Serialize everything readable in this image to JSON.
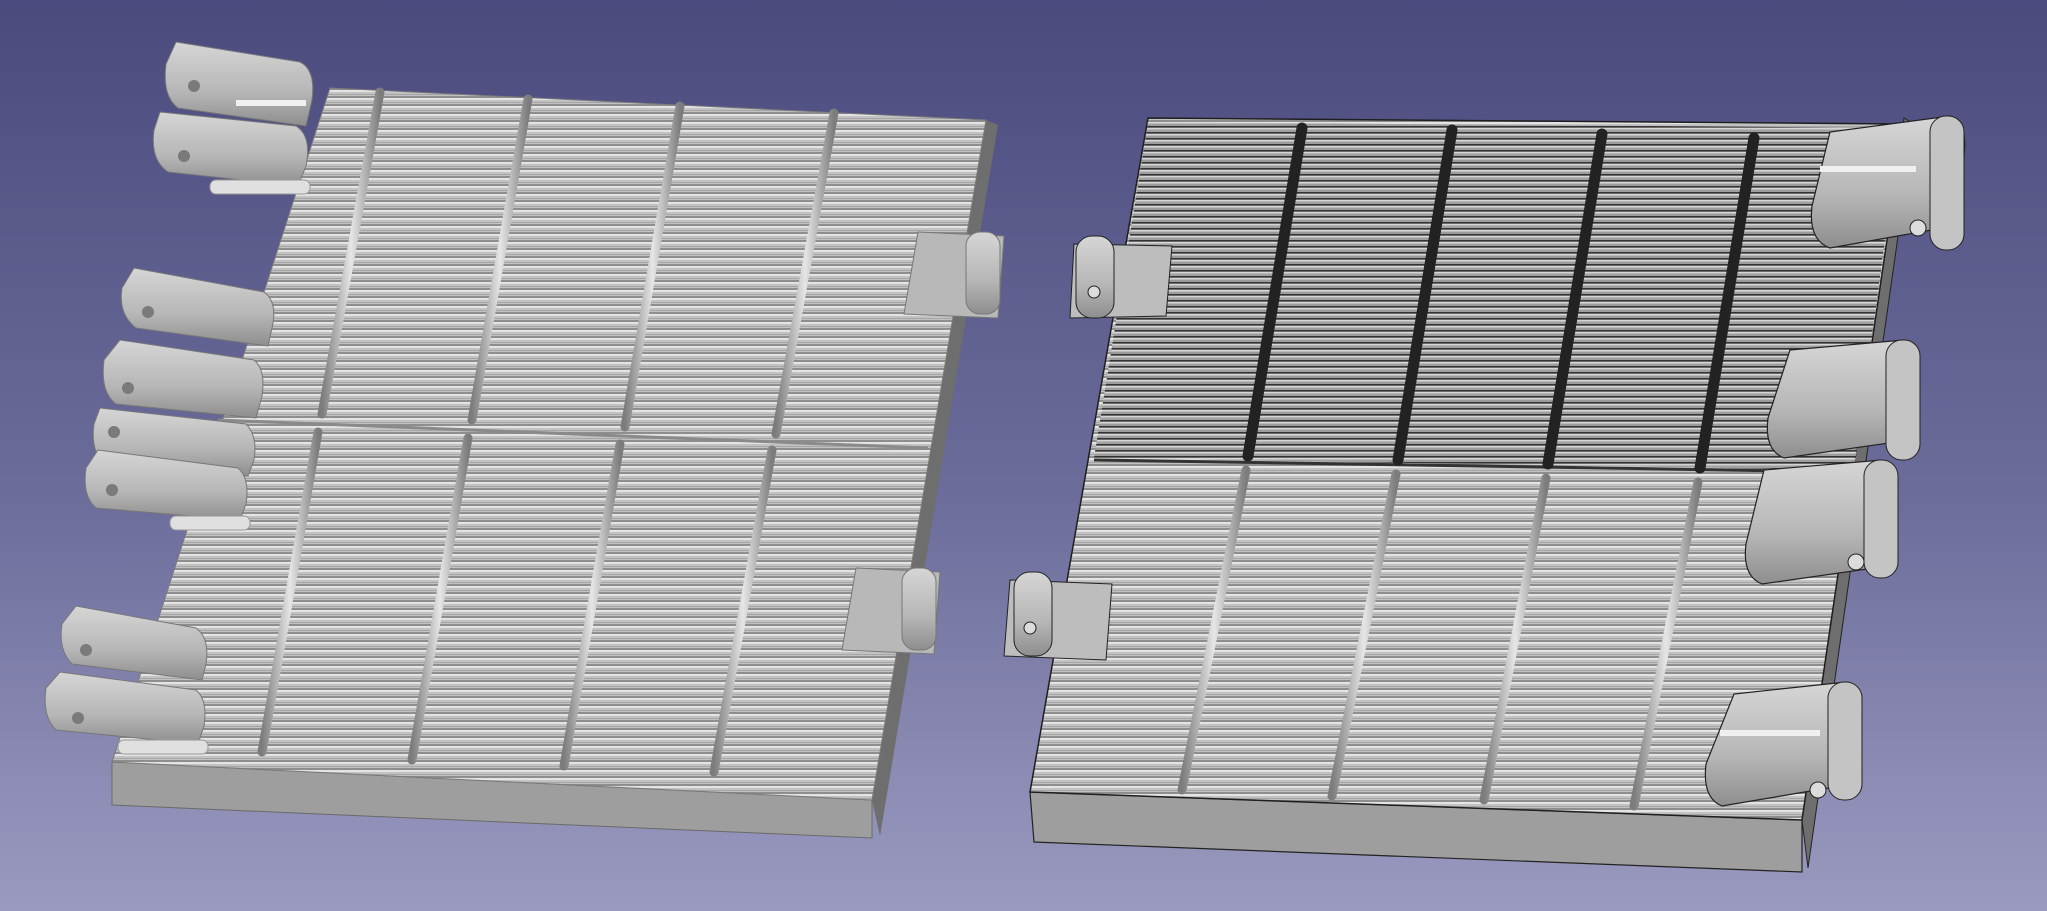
{
  "app": {
    "name": "3D CAD viewport"
  },
  "scene": {
    "background_gradient": [
      "#4a4a7d",
      "#9a9ac0"
    ],
    "part_color": "#b4b4b4",
    "edge_color": "#2a2a2a",
    "objects": [
      {
        "id": "panel-left",
        "label": "",
        "selected": false,
        "rods_per_half": 4,
        "hinge_knuckles": 4,
        "clips": 2
      },
      {
        "id": "panel-right",
        "label": "",
        "selected": true,
        "rods_per_half": 4,
        "hinge_knuckles": 4,
        "clips": 2
      }
    ]
  }
}
